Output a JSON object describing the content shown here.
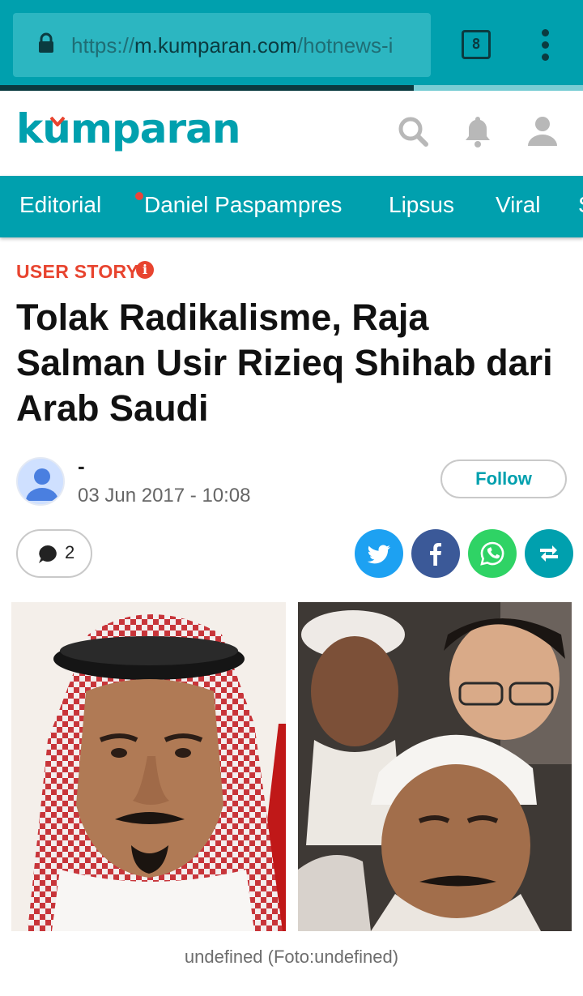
{
  "browser": {
    "url_scheme": "https://",
    "url_host": "m.kumparan.com",
    "url_path": "/hotnews-i",
    "tab_count": "8",
    "load_progress": 0.71
  },
  "site": {
    "logo_before": "k",
    "logo_u": "u",
    "logo_after": "mparan",
    "brand_color": "#00a0ae",
    "accent_color": "#e8442f",
    "header_icons": [
      "search-icon",
      "bell-icon",
      "user-icon"
    ]
  },
  "nav": {
    "items": [
      "Editorial",
      "Daniel Paspampres",
      "Lipsus",
      "Viral",
      "S"
    ]
  },
  "article": {
    "kicker": "USER STORY",
    "kicker_icon": "i",
    "headline": "Tolak Radikalisme, Raja Salman Usir Rizieq Shihab dari Arab Saudi",
    "author": "-",
    "date": "03 Jun 2017 - 10:08",
    "follow_label": "Follow",
    "comment_count": "2",
    "share_buttons": [
      "twitter-icon",
      "facebook-icon",
      "whatsapp-icon",
      "repost-icon"
    ],
    "caption": "undefined (Foto:undefined)"
  }
}
